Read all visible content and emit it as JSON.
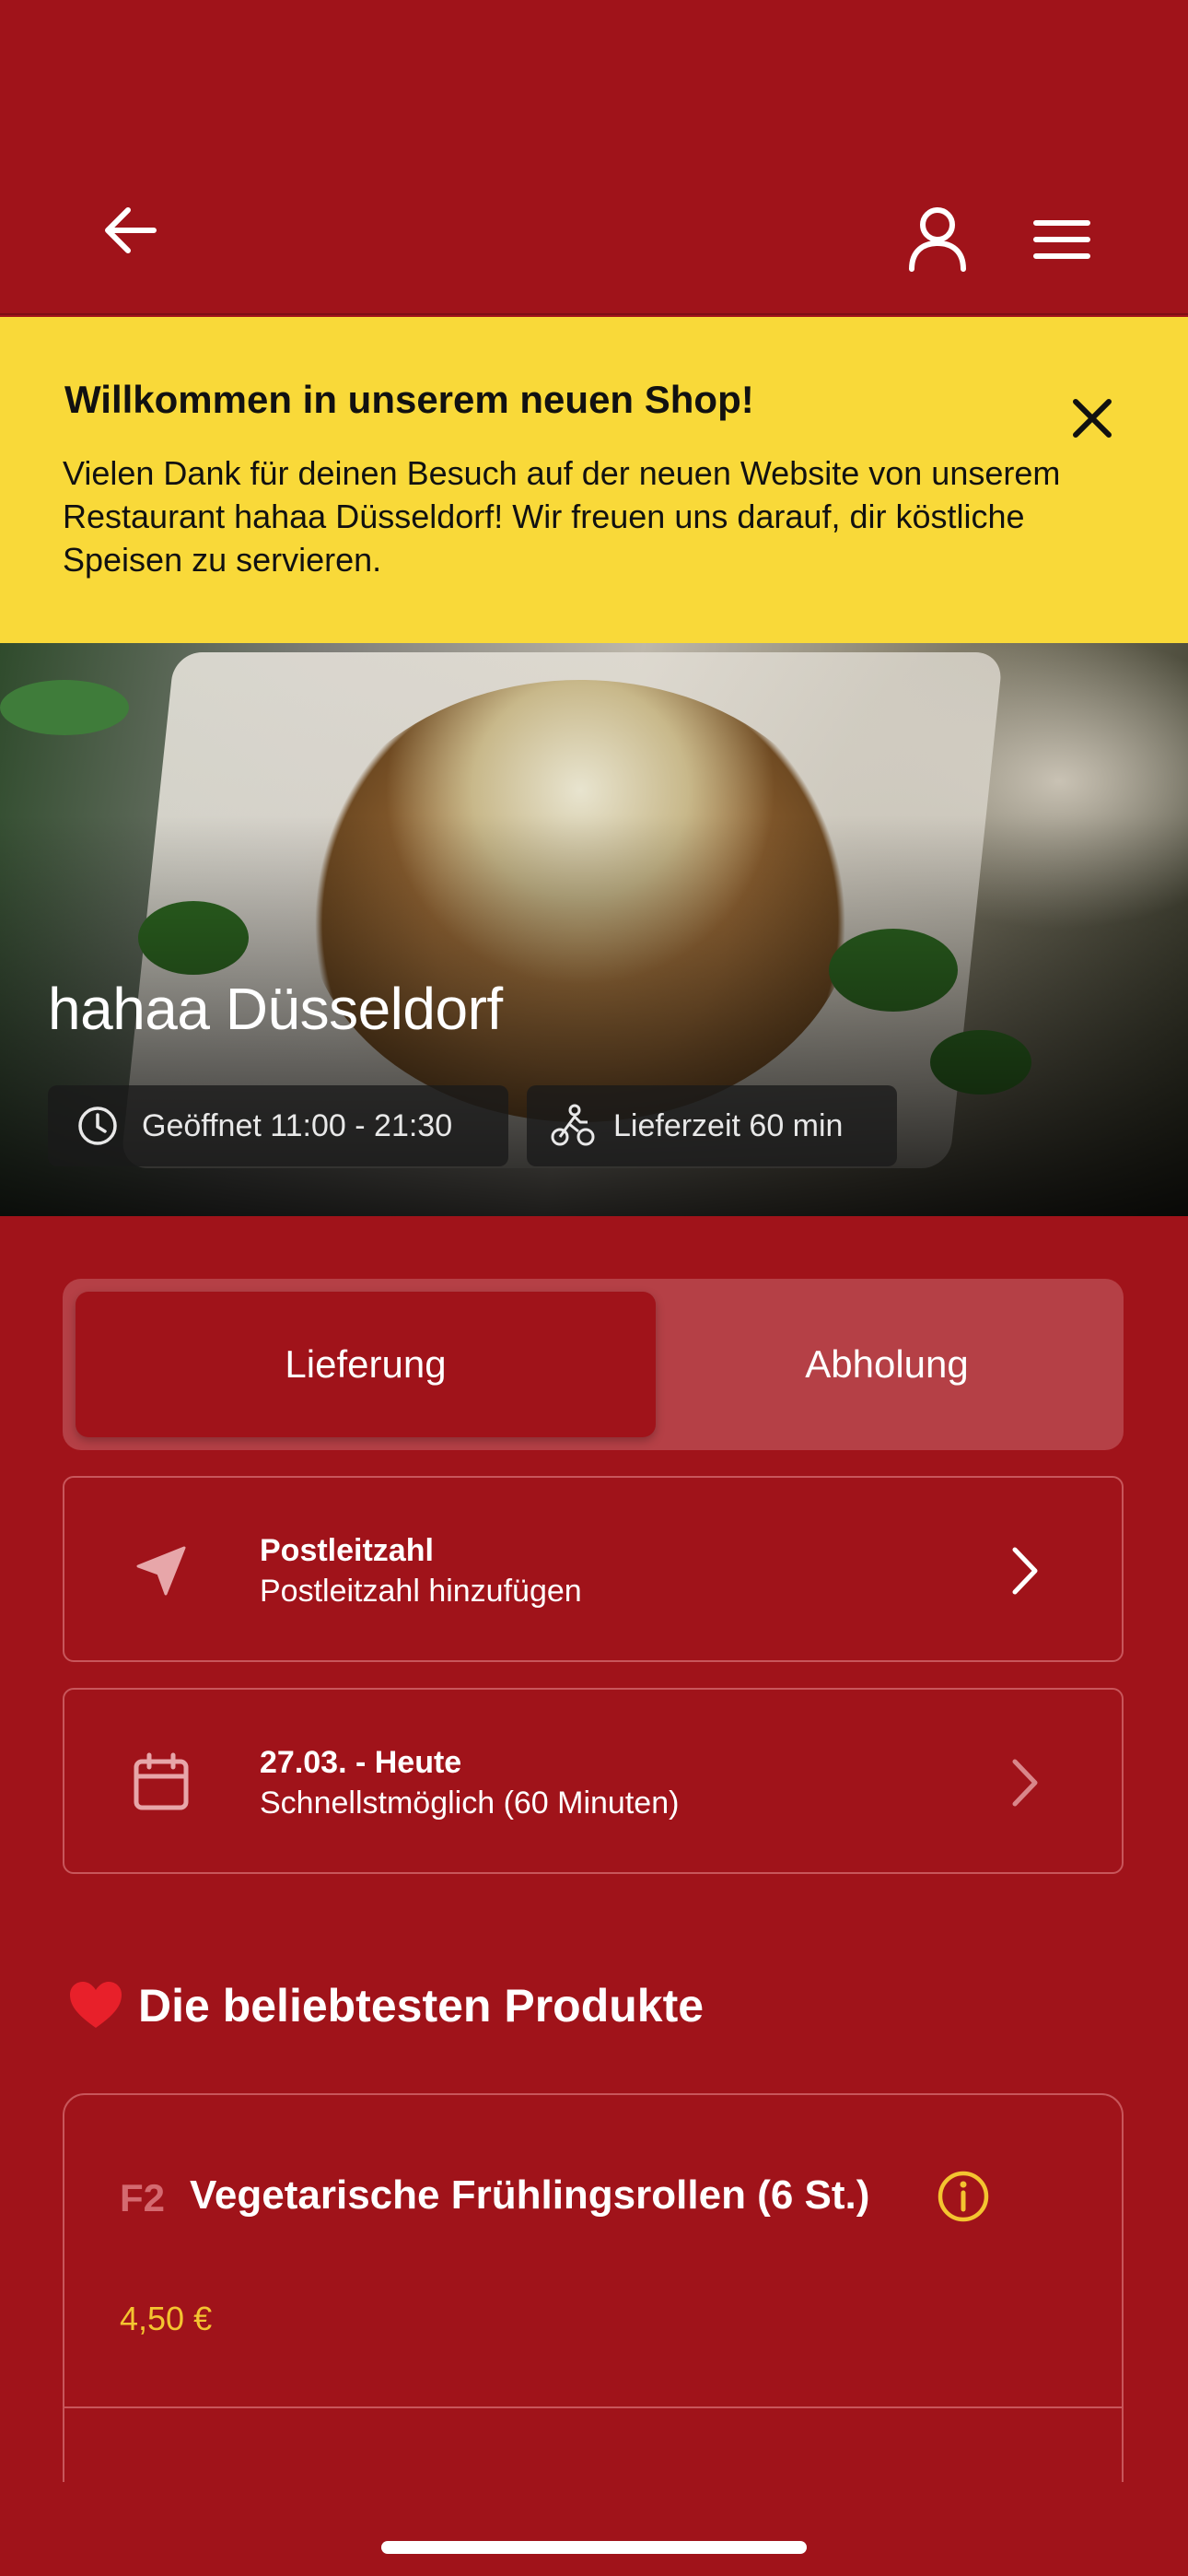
{
  "header": {
    "back_icon": "arrow-left-icon",
    "account_icon": "user-icon",
    "menu_icon": "hamburger-menu-icon"
  },
  "banner": {
    "title": "Willkommen in unserem neuen Shop!",
    "text": "Vielen Dank für deinen Besuch auf der neuen Website von unserem Restaurant hahaa Düsseldorf! Wir freuen uns darauf, dir köstliche Speisen zu servieren.",
    "close_icon": "close-icon",
    "color": "#f9d939"
  },
  "hero": {
    "restaurant_name": "hahaa Düsseldorf",
    "opening_hours": "Geöffnet 11:00 - 21:30",
    "delivery_time": "Lieferzeit 60 min"
  },
  "order_mode": {
    "delivery_label": "Lieferung",
    "pickup_label": "Abholung",
    "selected": "Lieferung"
  },
  "postal": {
    "title": "Postleitzahl",
    "subtitle": "Postleitzahl hinzufügen"
  },
  "schedule": {
    "title": "27.03. - Heute",
    "subtitle": "Schnellstmöglich (60 Minuten)"
  },
  "popular": {
    "title": "Die beliebtesten Produkte",
    "products": [
      {
        "code": "F2",
        "name": "Vegetarische Frühlingsrollen (6 St.)",
        "price": "4,50 €"
      }
    ]
  },
  "colors": {
    "primary": "#a0131a",
    "accent": "#f4c430",
    "border": "#c8565b"
  }
}
